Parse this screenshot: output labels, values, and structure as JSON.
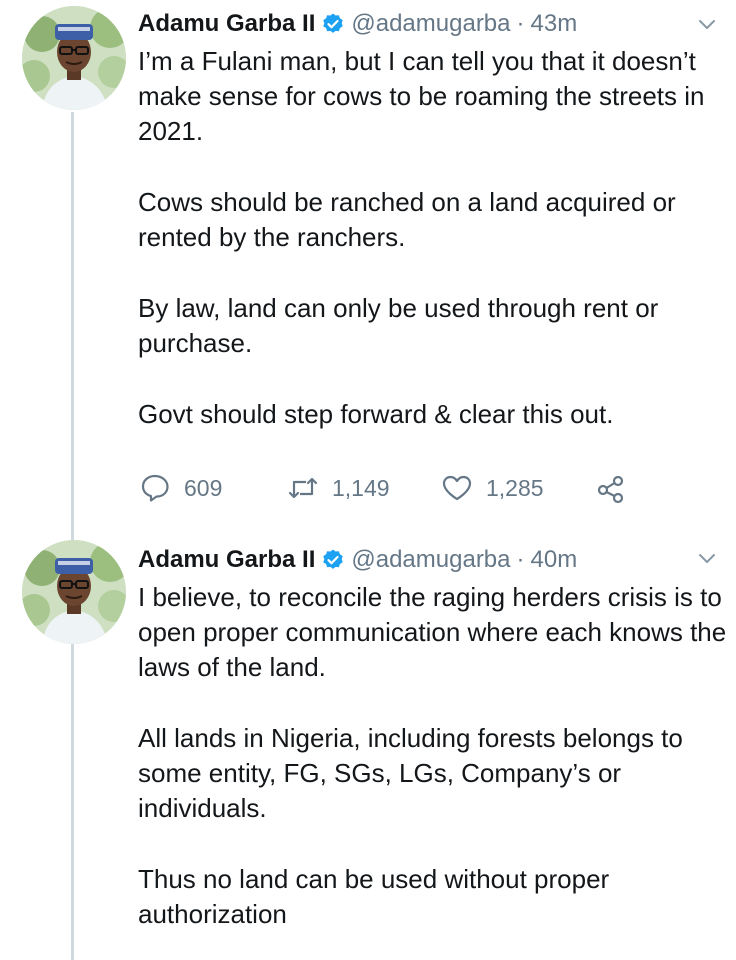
{
  "colors": {
    "text": "#14171a",
    "secondary": "#657786",
    "verified": "#1da1f2",
    "thread_line": "#cfd9de"
  },
  "tweets": [
    {
      "author": {
        "name": "Adamu Garba II",
        "handle": "@adamugarba",
        "verified": true
      },
      "separator": "·",
      "time": "43m",
      "paragraphs": [
        "I’m a Fulani man, but I can tell you that it doesn’t make sense for cows to be roaming the streets in 2021.",
        "Cows should be ranched on a land acquired or rented by the ranchers.",
        "By law, land can only be used through rent or purchase.",
        "Govt should step forward & clear this out."
      ],
      "actions": {
        "replies": "609",
        "retweets": "1,149",
        "likes": "1,285"
      },
      "icons": [
        "reply-icon",
        "retweet-icon",
        "like-icon",
        "share-icon"
      ]
    },
    {
      "author": {
        "name": "Adamu Garba II",
        "handle": "@adamugarba",
        "verified": true
      },
      "separator": "·",
      "time": "40m",
      "paragraphs": [
        "I believe, to reconcile the raging herders crisis is to open proper communication where each knows the laws of the land.",
        "All lands in Nigeria, including forests belongs to some entity, FG, SGs, LGs, Company’s or individuals.",
        "Thus no land can be used without proper authorization"
      ]
    }
  ]
}
